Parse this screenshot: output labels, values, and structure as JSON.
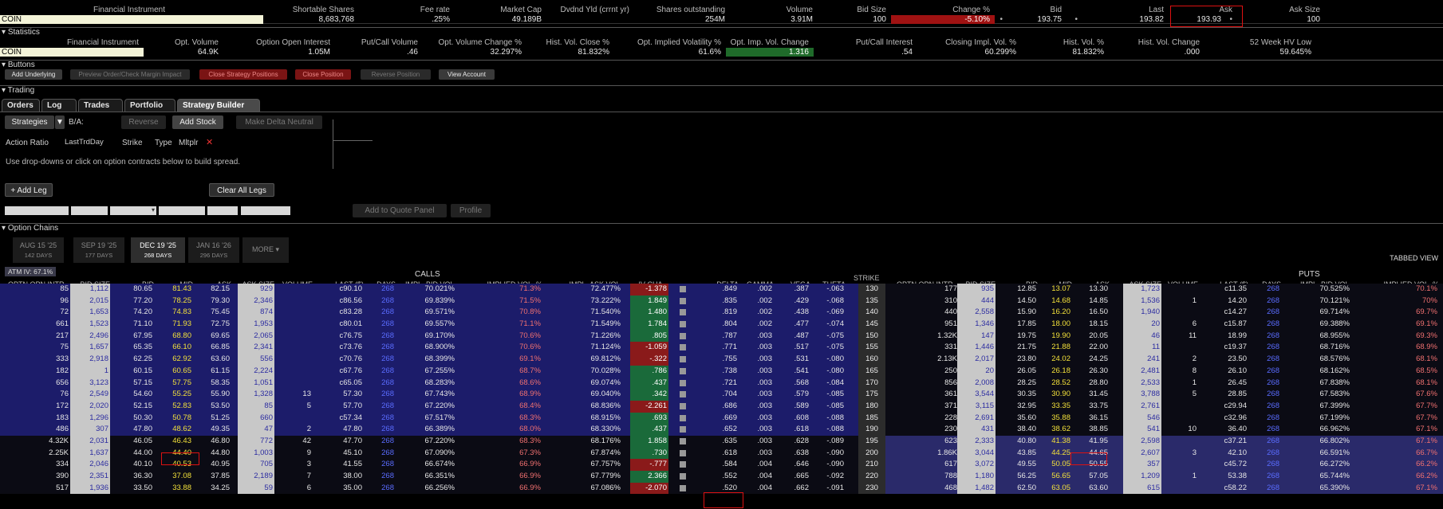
{
  "top_headers": [
    "Financial Instrument",
    "Shortable Shares",
    "Fee rate",
    "Market Cap",
    "Dvdnd Yld (crrnt yr)",
    "Shares outstanding",
    "Volume",
    "Bid Size",
    "Change %",
    "Bid",
    "Last",
    "Ask",
    "Ask Size"
  ],
  "top_values": {
    "symbol": "COIN",
    "shortable": "8,683,768",
    "fee": ".25%",
    "mcap": "49.189B",
    "yld": "",
    "shares_out": "254M",
    "volume": "3.91M",
    "bid_size": "100",
    "change": "-5.10%",
    "bid_mark": "•",
    "bid": "193.75",
    "last_mark": "•",
    "last": "193.82",
    "ask": "193.93",
    "ask_mark": "•",
    "ask_size": "100"
  },
  "stats_label": "Statistics",
  "stats_headers": [
    "Financial Instrument",
    "Opt. Volume",
    "Option Open Interest",
    "Put/Call Volume",
    "Opt. Volume Change %",
    "Hist. Vol. Close %",
    "Opt. Implied Volatility %",
    "Opt. Imp. Vol. Change",
    "Put/Call Interest",
    "Closing Impl. Vol. %",
    "Hist. Vol. %",
    "Hist. Vol. Change",
    "52 Week HV Low"
  ],
  "stats_values": [
    "COIN",
    "64.9K",
    "1.05M",
    ".46",
    "32.297%",
    "81.832%",
    "61.6%",
    "1.316",
    ".54",
    "60.299%",
    "81.832%",
    ".000",
    "59.645%"
  ],
  "buttons_label": "Buttons",
  "buttons": [
    "Add Underlying",
    "Preview Order/Check Margin Impact",
    "Close Strategy Positions",
    "Close Position",
    "Reverse Position",
    "View Account"
  ],
  "trading_label": "Trading",
  "tabs": [
    "Orders",
    "Log",
    "Trades",
    "Portfolio",
    "Strategy Builder"
  ],
  "strategy": {
    "strategies": "Strategies",
    "ba": "B/A:",
    "reverse": "Reverse",
    "add_stock": "Add Stock",
    "delta_neutral": "Make Delta Neutral",
    "action_ratio": "Action Ratio",
    "last_trd_day": "LastTrdDay",
    "strike": "Strike",
    "type": "Type",
    "mltplr": "Mltplr",
    "x": "✕",
    "hint": "Use drop-downs or click on option contracts below to build spread.",
    "add_leg": "+ Add Leg",
    "clear_legs": "Clear All Legs",
    "add_quote": "Add to Quote Panel",
    "profile": "Profile"
  },
  "chains_label": "Option Chains",
  "expiries": [
    {
      "d": "AUG 15 '25",
      "n": "142 DAYS"
    },
    {
      "d": "SEP 19 '25",
      "n": "177 DAYS"
    },
    {
      "d": "DEC 19 '25",
      "n": "268 DAYS"
    },
    {
      "d": "JAN 16 '26",
      "n": "296 DAYS"
    },
    {
      "d": "MORE ▾",
      "n": ""
    }
  ],
  "tabbed_view": "TABBED VIEW",
  "atm_iv": "ATM IV: 67.1%",
  "calls_label": "CALLS",
  "puts_label": "PUTS",
  "strike_label": "STRIKE",
  "call_headers": [
    "OPTN OPN INTR...",
    "BID SIZE",
    "BID",
    "MID",
    "ASK",
    "ASK SIZE",
    "VOLUME",
    "LAST ($)",
    "DAYS",
    "IMPL. BID VOL.",
    "IMPLIED VOL. %",
    "IMPL. ASK VOL.",
    "IV CHA...",
    "DELTA",
    "GAMMA",
    "VEGA",
    "THETA"
  ],
  "put_headers": [
    "OPTN OPN INTR...",
    "BID SIZE",
    "BID",
    "MID",
    "ASK",
    "ASK SIZE",
    "VOLUME",
    "LAST ($)",
    "DAYS",
    "IMPL. BID VOL.",
    "IMPLIED VOL. %"
  ],
  "rows": [
    {
      "strike": "130",
      "c": [
        "85",
        "1,112",
        "80.65",
        "81.43",
        "82.15",
        "929",
        "",
        "c90.10",
        "268",
        "70.021%",
        "71.3%",
        "72.477%",
        "-1.378",
        ".849",
        ".002",
        ".387",
        "-.063"
      ],
      "p": [
        "177",
        "935",
        "12.85",
        "13.07",
        "13.30",
        "1,723",
        "",
        "c11.35",
        "268",
        "70.525%",
        "70.1%"
      ]
    },
    {
      "strike": "135",
      "c": [
        "96",
        "2,015",
        "77.20",
        "78.25",
        "79.30",
        "2,346",
        "",
        "c86.56",
        "268",
        "69.839%",
        "71.5%",
        "73.222%",
        "1.849",
        ".835",
        ".002",
        ".429",
        "-.068"
      ],
      "p": [
        "310",
        "444",
        "14.50",
        "14.68",
        "14.85",
        "1,536",
        "1",
        "14.20",
        "268",
        "70.121%",
        "70%"
      ]
    },
    {
      "strike": "140",
      "c": [
        "72",
        "1,653",
        "74.20",
        "74.83",
        "75.45",
        "874",
        "",
        "c83.28",
        "268",
        "69.571%",
        "70.8%",
        "71.540%",
        "1.480",
        ".819",
        ".002",
        ".438",
        "-.069"
      ],
      "p": [
        "440",
        "2,558",
        "15.90",
        "16.20",
        "16.50",
        "1,940",
        "",
        "c14.27",
        "268",
        "69.714%",
        "69.7%"
      ]
    },
    {
      "strike": "145",
      "c": [
        "661",
        "1,523",
        "71.10",
        "71.93",
        "72.75",
        "1,953",
        "",
        "c80.01",
        "268",
        "69.557%",
        "71.1%",
        "71.549%",
        "1.784",
        ".804",
        ".002",
        ".477",
        "-.074"
      ],
      "p": [
        "951",
        "1,346",
        "17.85",
        "18.00",
        "18.15",
        "20",
        "6",
        "c15.87",
        "268",
        "69.388%",
        "69.1%"
      ]
    },
    {
      "strike": "150",
      "c": [
        "217",
        "2,496",
        "67.95",
        "68.80",
        "69.65",
        "2,065",
        "",
        "c76.75",
        "268",
        "69.170%",
        "70.6%",
        "71.226%",
        ".805",
        ".787",
        ".003",
        ".487",
        "-.075"
      ],
      "p": [
        "1.32K",
        "147",
        "19.75",
        "19.90",
        "20.05",
        "46",
        "11",
        "18.99",
        "268",
        "68.955%",
        "69.3%"
      ]
    },
    {
      "strike": "155",
      "c": [
        "75",
        "1,657",
        "65.35",
        "66.10",
        "66.85",
        "2,341",
        "",
        "c73.76",
        "268",
        "68.900%",
        "70.6%",
        "71.124%",
        "-1.059",
        ".771",
        ".003",
        ".517",
        "-.075"
      ],
      "p": [
        "331",
        "1,446",
        "21.75",
        "21.88",
        "22.00",
        "11",
        "",
        "c19.37",
        "268",
        "68.716%",
        "68.9%"
      ]
    },
    {
      "strike": "160",
      "c": [
        "333",
        "2,918",
        "62.25",
        "62.92",
        "63.60",
        "556",
        "",
        "c70.76",
        "268",
        "68.399%",
        "69.1%",
        "69.812%",
        "-.322",
        ".755",
        ".003",
        ".531",
        "-.080"
      ],
      "p": [
        "2.13K",
        "2,017",
        "23.80",
        "24.02",
        "24.25",
        "241",
        "2",
        "23.50",
        "268",
        "68.576%",
        "68.1%"
      ]
    },
    {
      "strike": "165",
      "c": [
        "182",
        "1",
        "60.15",
        "60.65",
        "61.15",
        "2,224",
        "",
        "c67.76",
        "268",
        "67.255%",
        "68.7%",
        "70.028%",
        ".786",
        ".738",
        ".003",
        ".541",
        "-.080"
      ],
      "p": [
        "250",
        "20",
        "26.05",
        "26.18",
        "26.30",
        "2,481",
        "8",
        "26.10",
        "268",
        "68.162%",
        "68.5%"
      ]
    },
    {
      "strike": "170",
      "c": [
        "656",
        "3,123",
        "57.15",
        "57.75",
        "58.35",
        "1,051",
        "",
        "c65.05",
        "268",
        "68.283%",
        "68.6%",
        "69.074%",
        ".437",
        ".721",
        ".003",
        ".568",
        "-.084"
      ],
      "p": [
        "856",
        "2,008",
        "28.25",
        "28.52",
        "28.80",
        "2,533",
        "1",
        "26.45",
        "268",
        "67.838%",
        "68.1%"
      ]
    },
    {
      "strike": "175",
      "c": [
        "76",
        "2,549",
        "54.60",
        "55.25",
        "55.90",
        "1,328",
        "13",
        "57.30",
        "268",
        "67.743%",
        "68.9%",
        "69.040%",
        ".342",
        ".704",
        ".003",
        ".579",
        "-.085"
      ],
      "p": [
        "361",
        "3,544",
        "30.35",
        "30.90",
        "31.45",
        "3,788",
        "5",
        "28.85",
        "268",
        "67.583%",
        "67.6%"
      ]
    },
    {
      "strike": "180",
      "c": [
        "172",
        "2,020",
        "52.15",
        "52.83",
        "53.50",
        "85",
        "5",
        "57.70",
        "268",
        "67.220%",
        "68.4%",
        "68.836%",
        "-2.261",
        ".686",
        ".003",
        ".589",
        "-.085"
      ],
      "p": [
        "371",
        "3,115",
        "32.95",
        "33.35",
        "33.75",
        "2,761",
        "",
        "c29.94",
        "268",
        "67.399%",
        "67.7%"
      ]
    },
    {
      "strike": "185",
      "c": [
        "183",
        "1,296",
        "50.30",
        "50.78",
        "51.25",
        "660",
        "",
        "c57.34",
        "268",
        "67.517%",
        "68.3%",
        "68.915%",
        ".693",
        ".669",
        ".003",
        ".608",
        "-.088"
      ],
      "p": [
        "228",
        "2,691",
        "35.60",
        "35.88",
        "36.15",
        "546",
        "",
        "c32.96",
        "268",
        "67.199%",
        "67.7%"
      ]
    },
    {
      "strike": "190",
      "c": [
        "486",
        "307",
        "47.80",
        "48.62",
        "49.35",
        "47",
        "2",
        "47.80",
        "268",
        "66.389%",
        "68.0%",
        "68.330%",
        ".437",
        ".652",
        ".003",
        ".618",
        "-.088"
      ],
      "p": [
        "230",
        "431",
        "38.40",
        "38.62",
        "38.85",
        "541",
        "10",
        "36.40",
        "268",
        "66.962%",
        "67.1%"
      ]
    },
    {
      "strike": "195",
      "c": [
        "4.32K",
        "2,031",
        "46.05",
        "46.43",
        "46.80",
        "772",
        "42",
        "47.70",
        "268",
        "67.220%",
        "68.3%",
        "68.176%",
        "1.858",
        ".635",
        ".003",
        ".628",
        "-.089"
      ],
      "p": [
        "623",
        "2,333",
        "40.80",
        "41.38",
        "41.95",
        "2,598",
        "",
        "c37.21",
        "268",
        "66.802%",
        "67.1%"
      ]
    },
    {
      "strike": "200",
      "c": [
        "2.25K",
        "1,637",
        "44.00",
        "44.40",
        "44.80",
        "1,003",
        "9",
        "45.10",
        "268",
        "67.090%",
        "67.3%",
        "67.874%",
        ".730",
        ".618",
        ".003",
        ".638",
        "-.090"
      ],
      "p": [
        "1.86K",
        "3,044",
        "43.85",
        "44.25",
        "44.65",
        "2,607",
        "3",
        "42.10",
        "268",
        "66.591%",
        "66.7%"
      ]
    },
    {
      "strike": "210",
      "c": [
        "334",
        "2,046",
        "40.10",
        "40.53",
        "40.95",
        "705",
        "3",
        "41.55",
        "268",
        "66.674%",
        "66.9%",
        "67.757%",
        "-.777",
        ".584",
        ".004",
        ".646",
        "-.090"
      ],
      "p": [
        "617",
        "3,072",
        "49.55",
        "50.05",
        "50.55",
        "357",
        "",
        "c45.72",
        "268",
        "66.272%",
        "66.2%"
      ]
    },
    {
      "strike": "220",
      "c": [
        "390",
        "2,351",
        "36.30",
        "37.08",
        "37.85",
        "2,189",
        "7",
        "38.00",
        "268",
        "66.351%",
        "66.9%",
        "67.779%",
        "2.366",
        ".552",
        ".004",
        ".665",
        "-.092"
      ],
      "p": [
        "788",
        "1,180",
        "56.25",
        "56.65",
        "57.05",
        "1,209",
        "1",
        "53.38",
        "268",
        "65.744%",
        "66.2%"
      ]
    },
    {
      "strike": "230",
      "c": [
        "517",
        "1,936",
        "33.50",
        "33.88",
        "34.25",
        "59",
        "6",
        "35.00",
        "268",
        "66.256%",
        "66.9%",
        "67.086%",
        "-2.070",
        ".520",
        ".004",
        ".662",
        "-.091"
      ],
      "p": [
        "468",
        "1,482",
        "62.50",
        "63.05",
        "63.60",
        "615",
        "",
        "c58.22",
        "268",
        "65.390%",
        "67.1%"
      ]
    }
  ]
}
